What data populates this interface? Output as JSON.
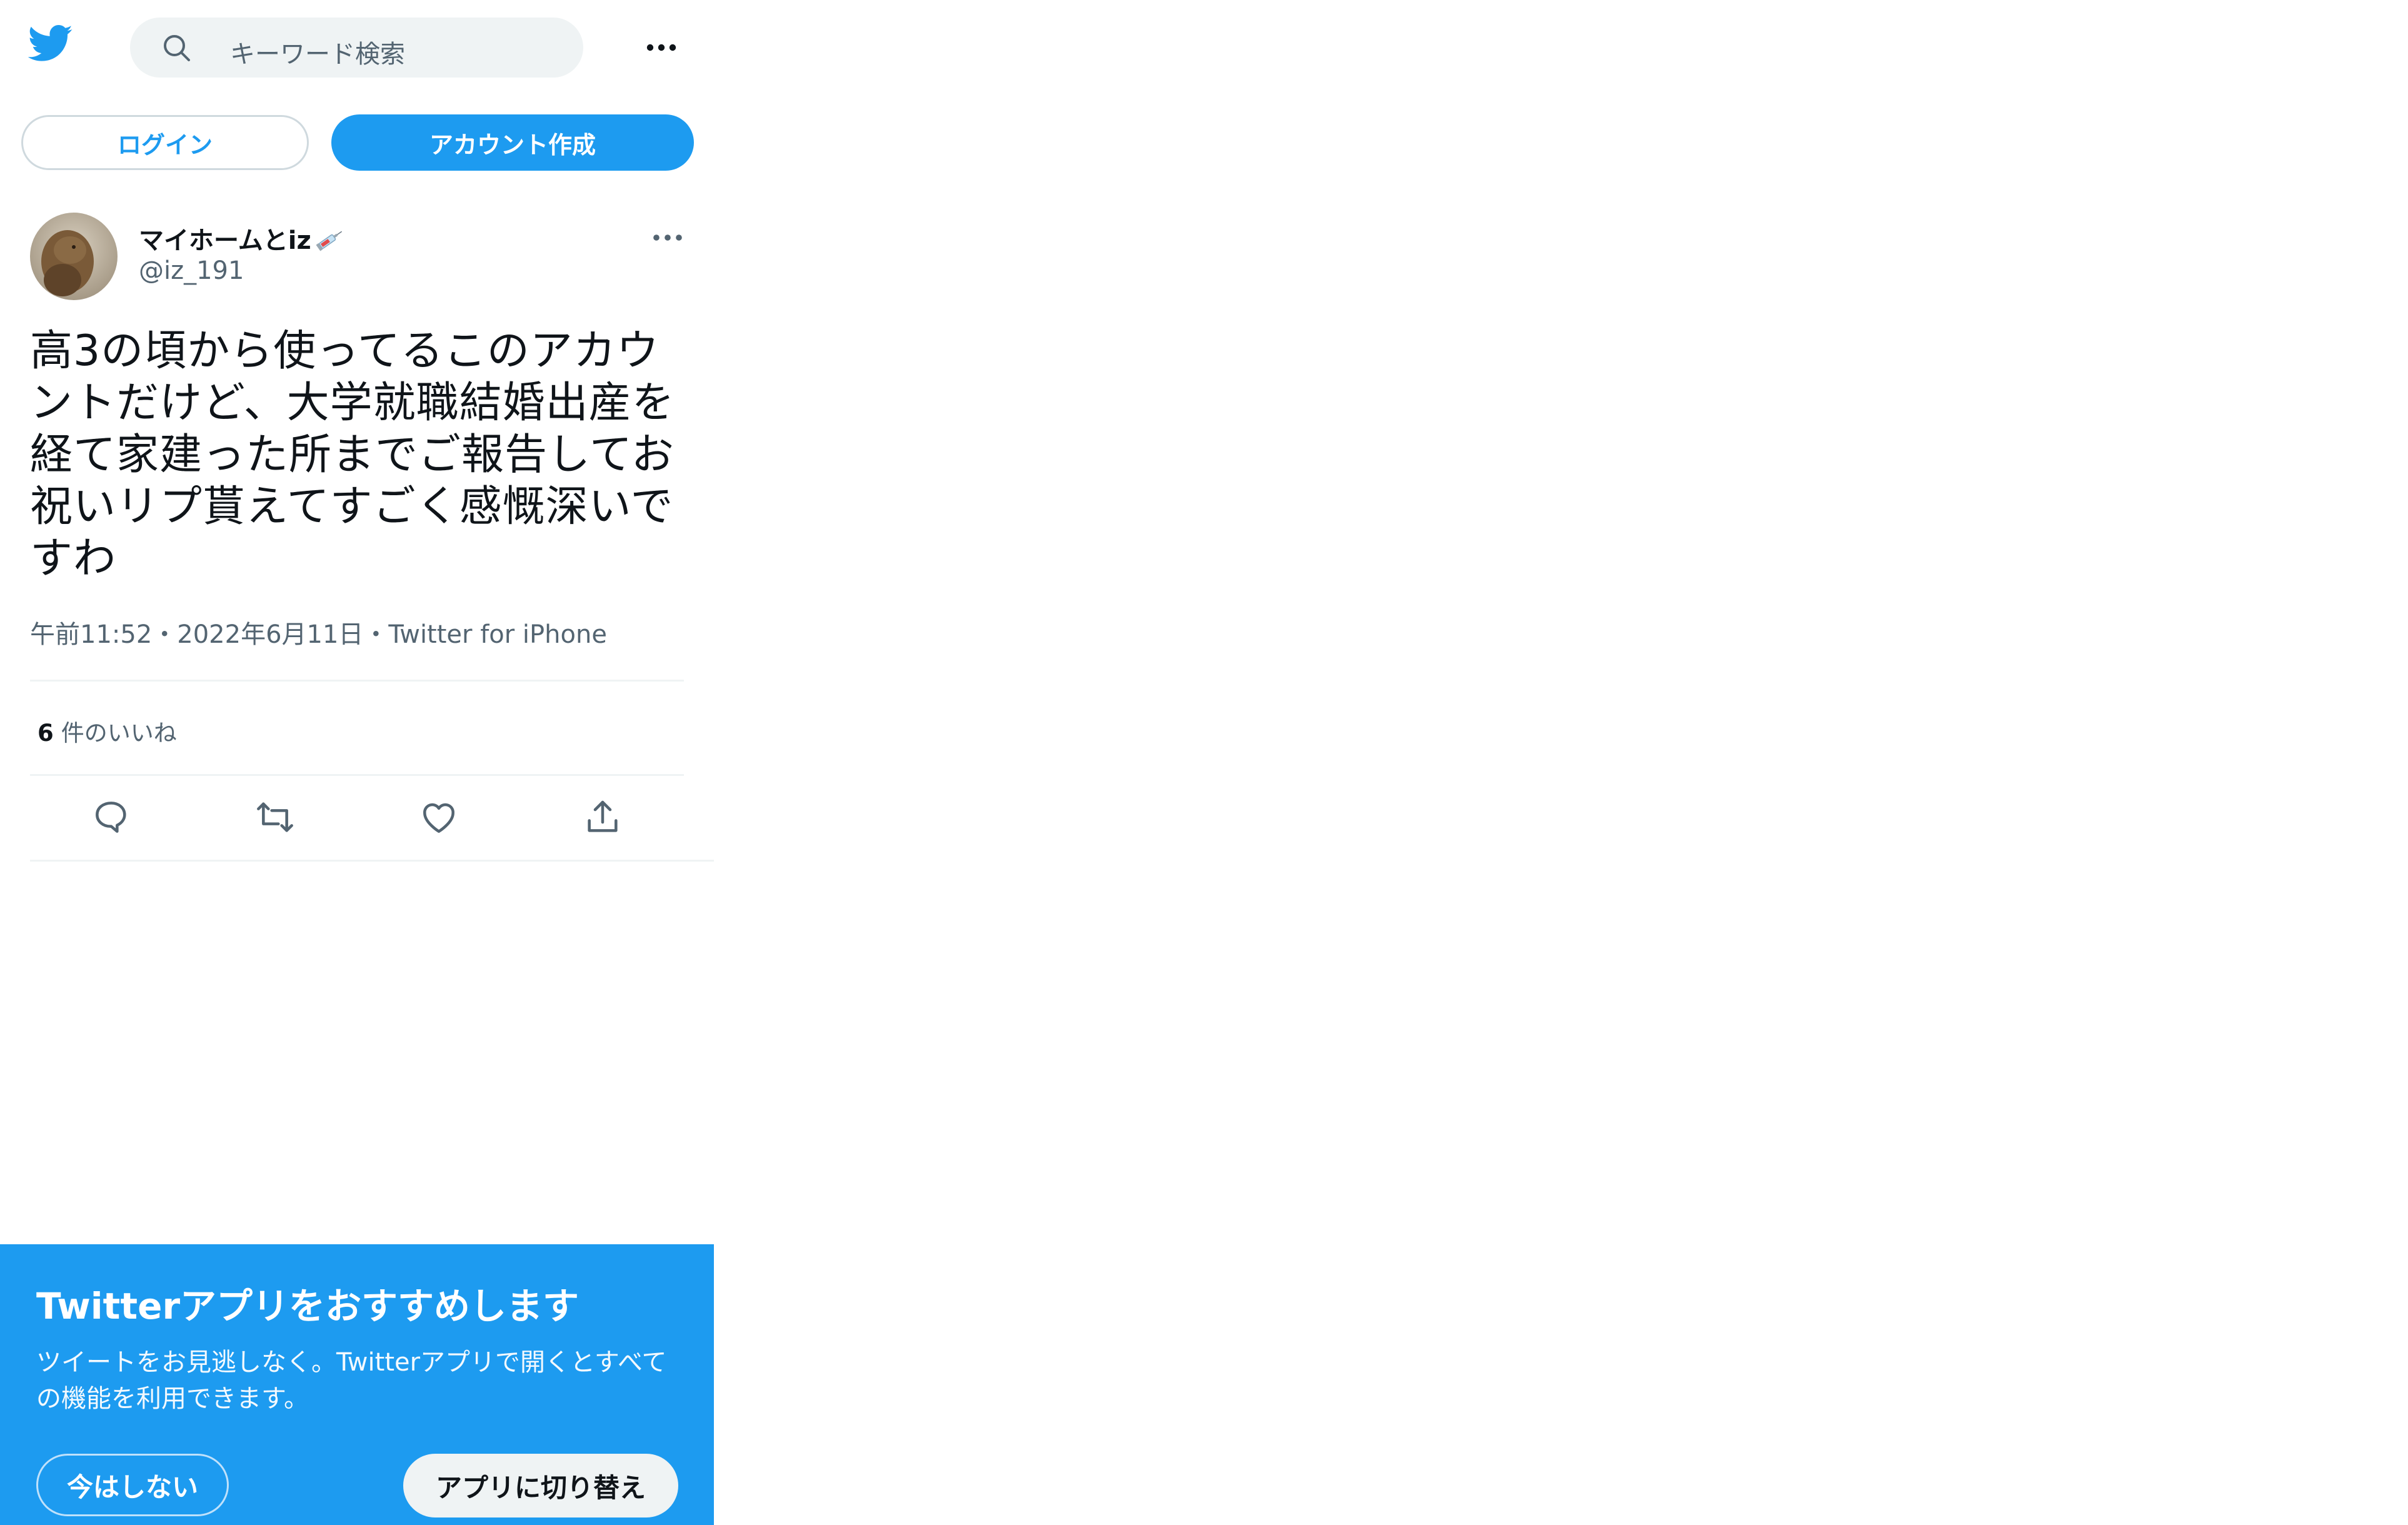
{
  "header": {
    "search_placeholder": "キーワード検索"
  },
  "auth": {
    "login_label": "ログイン",
    "signup_label": "アカウント作成"
  },
  "tweet": {
    "display_name": "マイホームとiz",
    "handle": "@iz_191",
    "text": "高3の頃から使ってるこのアカウントだけど、大学就職結婚出産を経て家建った所までご報告してお祝いリプ貰えてすごく感慨深いですわ",
    "meta": "午前11:52・2022年6月11日・Twitter for iPhone",
    "likes_count": "6",
    "likes_label": "件のいいね"
  },
  "banner": {
    "title": "Twitterアプリをおすすめします",
    "description": "ツイートをお見逃しなく。Twitterアプリで開くとすべての機能を利用できます。",
    "not_now_label": "今はしない",
    "switch_label": "アプリに切り替え"
  },
  "colors": {
    "brand": "#1d9bf0",
    "secondary_text": "#536471",
    "divider": "#eff3f4"
  },
  "icons": [
    "twitter-bird-icon",
    "search-icon",
    "more-icon",
    "syringe-emoji",
    "reply-icon",
    "retweet-icon",
    "like-icon",
    "share-icon"
  ]
}
